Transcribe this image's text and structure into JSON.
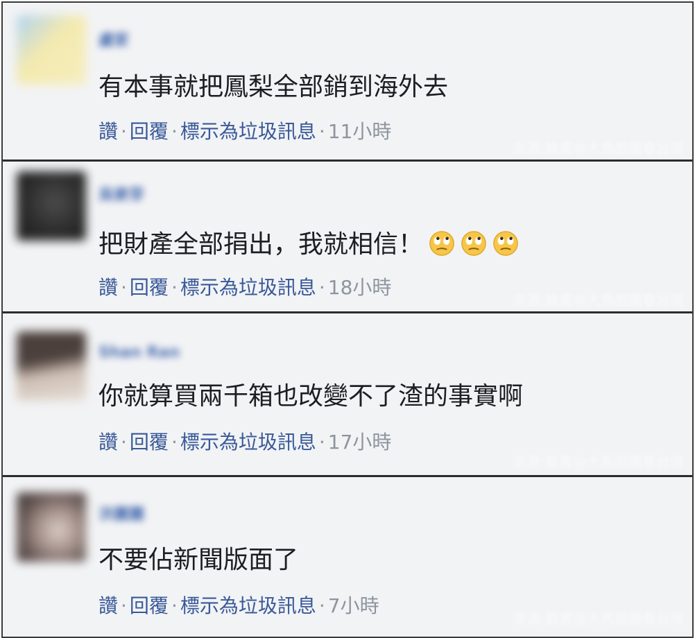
{
  "comments": [
    {
      "name": "盧家",
      "text": "有本事就把鳳梨全部銷到海外去",
      "emoji": [],
      "actions": {
        "like": "讚",
        "reply": "回覆",
        "spam": "標示為垃圾訊息",
        "time": "11小時"
      },
      "watermark": "來源:臉書@大馬戲團看台灣",
      "avatar_colors": [
        "#f4e9a8",
        "#8fc0e8"
      ]
    },
    {
      "name": "吳麥芽",
      "text": "把財產全部捐出，我就相信！",
      "emoji": [
        "rolling-eyes",
        "rolling-eyes",
        "rolling-eyes"
      ],
      "actions": {
        "like": "讚",
        "reply": "回覆",
        "spam": "標示為垃圾訊息",
        "time": "18小時"
      },
      "watermark": "來源:臉書@大馬戲團看台灣",
      "avatar_colors": [
        "#1a1a1a",
        "#3a3a3a"
      ]
    },
    {
      "name": "Shan Ran",
      "text": "你就算買兩千箱也改變不了渣的事實啊",
      "emoji": [],
      "actions": {
        "like": "讚",
        "reply": "回覆",
        "spam": "標示為垃圾訊息",
        "time": "17小時"
      },
      "watermark": "來源:臉書@大馬戲團看台灣",
      "avatar_colors": [
        "#3a2d28",
        "#d8cfc6"
      ]
    },
    {
      "name": "洪麗麗",
      "text": "不要佔新聞版面了",
      "emoji": [],
      "actions": {
        "like": "讚",
        "reply": "回覆",
        "spam": "標示為垃圾訊息",
        "time": "7小時"
      },
      "watermark": "來源:臉書@大馬戲團看台灣",
      "avatar_colors": [
        "#5a4a46",
        "#cdbdb8"
      ]
    }
  ],
  "colors": {
    "link": "#385898",
    "name": "#4a6fb0",
    "meta": "#8d949e",
    "text": "#1c1e21",
    "background": "#f2f3f5",
    "divider": "#2c2c2c"
  }
}
